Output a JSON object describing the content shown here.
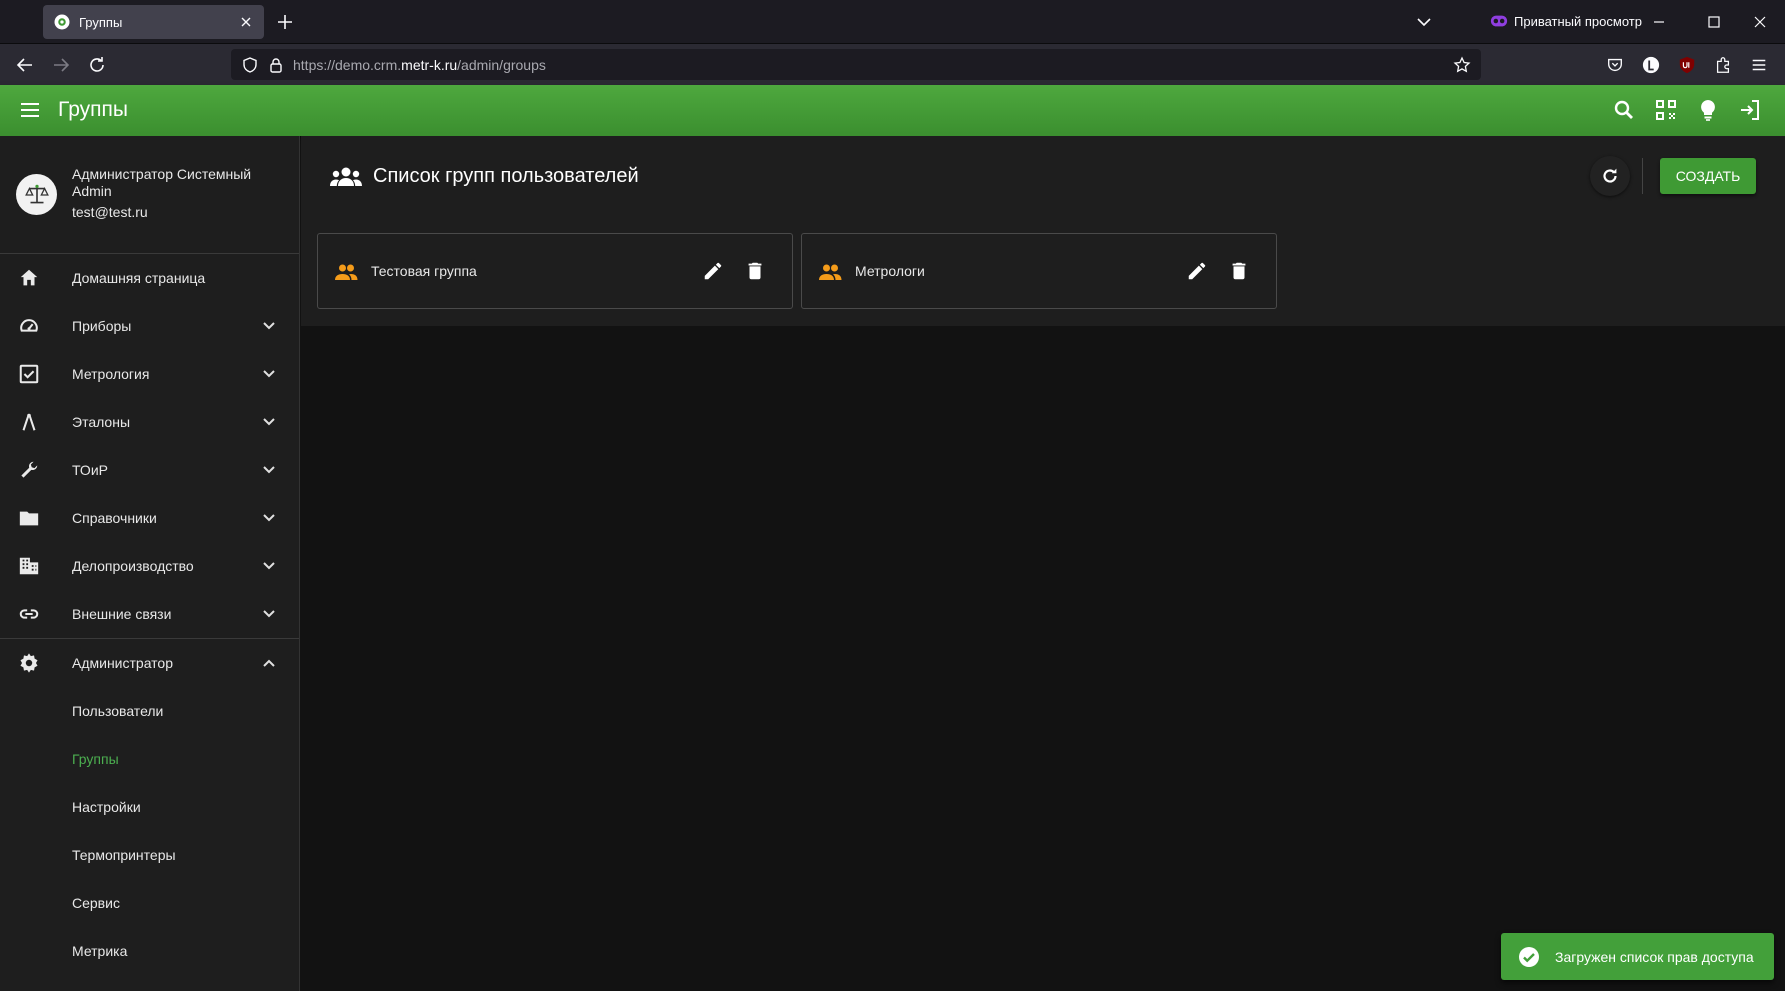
{
  "browser": {
    "tab_title": "Группы",
    "private_label": "Приватный просмотр",
    "url_prefix": "https://demo.crm.",
    "url_domain": "metr-k.ru",
    "url_path": "/admin/groups"
  },
  "appbar": {
    "title": "Группы"
  },
  "user": {
    "name": "Администратор Системный Admin",
    "email": "test@test.ru"
  },
  "sidebar": {
    "items": [
      {
        "label": "Домашняя страница",
        "icon": "home-icon"
      },
      {
        "label": "Приборы",
        "icon": "gauge-icon"
      },
      {
        "label": "Метрология",
        "icon": "checkbox-icon"
      },
      {
        "label": "Эталоны",
        "icon": "compass-icon"
      },
      {
        "label": "ТОиР",
        "icon": "wrench-icon"
      },
      {
        "label": "Справочники",
        "icon": "folder-icon"
      },
      {
        "label": "Делопроизводство",
        "icon": "office-icon"
      },
      {
        "label": "Внешние связи",
        "icon": "link-icon"
      },
      {
        "label": "Администратор",
        "icon": "gear-icon"
      }
    ],
    "admin_sub": [
      {
        "label": "Пользователи"
      },
      {
        "label": "Группы",
        "active": true
      },
      {
        "label": "Настройки"
      },
      {
        "label": "Термопринтеры"
      },
      {
        "label": "Сервис"
      },
      {
        "label": "Метрика"
      }
    ]
  },
  "main": {
    "title": "Список групп пользователей",
    "create_label": "СОЗДАТЬ",
    "groups": [
      {
        "name": "Тестовая группа"
      },
      {
        "name": "Метрологи"
      }
    ]
  },
  "snackbar": {
    "message": "Загружен список прав доступа"
  },
  "colors": {
    "brand_green": "#3f9a34",
    "group_icon": "#f59c1a",
    "active_link": "#4caf50"
  }
}
